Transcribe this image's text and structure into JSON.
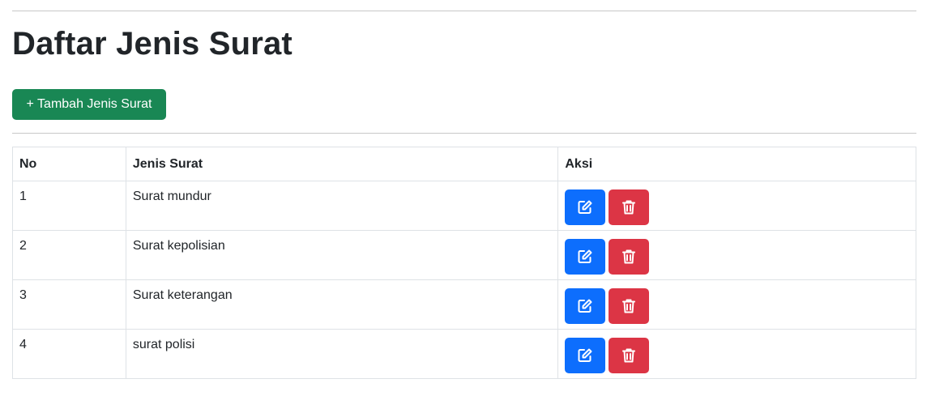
{
  "page": {
    "title": "Daftar Jenis Surat"
  },
  "toolbar": {
    "add_label": "+ Tambah Jenis Surat"
  },
  "table": {
    "headers": [
      "No",
      "Jenis Surat",
      "Aksi"
    ],
    "rows": [
      {
        "no": "1",
        "jenis": "Surat mundur"
      },
      {
        "no": "2",
        "jenis": "Surat kepolisian"
      },
      {
        "no": "3",
        "jenis": "Surat keterangan"
      },
      {
        "no": "4",
        "jenis": "surat polisi"
      }
    ]
  },
  "actions": {
    "edit_icon": "edit-icon",
    "delete_icon": "trash-icon"
  },
  "colors": {
    "primary": "#0d6efd",
    "danger": "#dc3545",
    "success": "#198754",
    "text": "#212529",
    "border": "#dee2e6"
  }
}
